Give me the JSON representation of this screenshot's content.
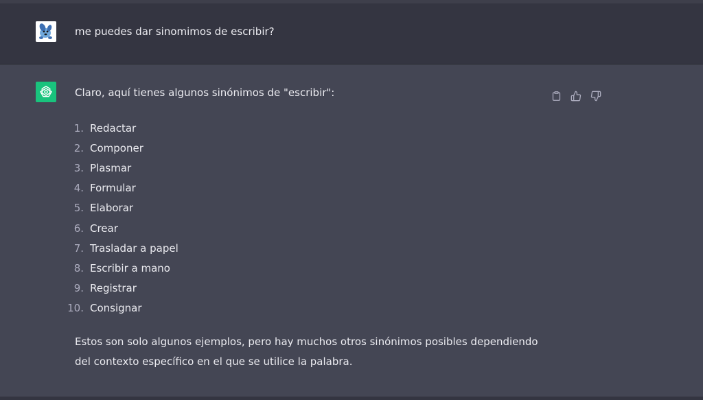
{
  "user_message": {
    "text": "me puedes dar sinomimos de escribir?"
  },
  "assistant_message": {
    "intro": "Claro, aquí tienes algunos sinónimos de \"escribir\":",
    "items": [
      {
        "num": "1.",
        "label": "Redactar"
      },
      {
        "num": "2.",
        "label": "Componer"
      },
      {
        "num": "3.",
        "label": "Plasmar"
      },
      {
        "num": "4.",
        "label": "Formular"
      },
      {
        "num": "5.",
        "label": "Elaborar"
      },
      {
        "num": "6.",
        "label": "Crear"
      },
      {
        "num": "7.",
        "label": "Trasladar a papel"
      },
      {
        "num": "8.",
        "label": "Escribir a mano"
      },
      {
        "num": "9.",
        "label": "Registrar"
      },
      {
        "num": "10.",
        "label": "Consignar"
      }
    ],
    "outro": "Estos son solo algunos ejemplos, pero hay muchos otros sinónimos posibles dependiendo del contexto específico en el que se utilice la palabra."
  },
  "actions": {
    "icons": [
      "clipboard-icon",
      "thumbs-up-icon",
      "thumbs-down-icon"
    ]
  },
  "colors": {
    "user_bg": "#343541",
    "assistant_bg": "#444654",
    "bot_avatar": "#19c37d",
    "text": "#ececf1",
    "muted": "#acacbe"
  }
}
